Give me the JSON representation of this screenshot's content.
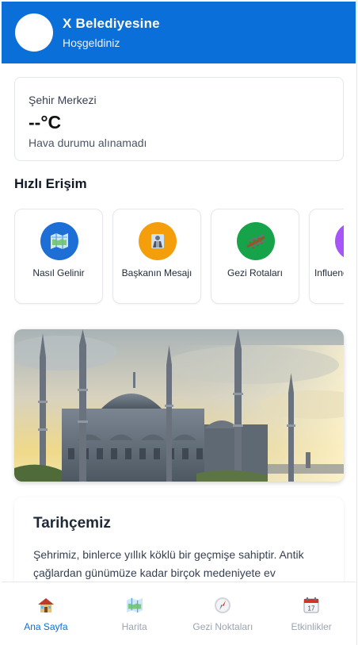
{
  "header": {
    "title": "X Belediyesine",
    "subtitle": "Hoşgeldiniz"
  },
  "weather": {
    "city": "Şehir Merkezi",
    "temperature": "--°C",
    "status": "Hava durumu alınamadı"
  },
  "quick_access": {
    "title": "Hızlı Erişim",
    "items": [
      {
        "label": "Nasıl Gelinir",
        "icon": "map-icon",
        "color": "#1d6fd6"
      },
      {
        "label": "Başkanın Mesajı",
        "icon": "speaker-icon",
        "color": "#f59e0b"
      },
      {
        "label": "Gezi Rotaları",
        "icon": "railway-icon",
        "color": "#16a34a"
      },
      {
        "label": "Influencer Rotaları",
        "icon": "person-icon",
        "color": "#a855f7"
      }
    ]
  },
  "hero": {
    "icon": "mosque-photo"
  },
  "history": {
    "title": "Tarihçemiz",
    "text": "Şehrimiz, binlerce yıllık köklü bir geçmişe sahiptir. Antik çağlardan günümüze kadar birçok medeniyete ev"
  },
  "bottom_nav": {
    "items": [
      {
        "label": "Ana Sayfa",
        "icon": "house-icon",
        "active": true
      },
      {
        "label": "Harita",
        "icon": "map-icon",
        "active": false
      },
      {
        "label": "Gezi Noktaları",
        "icon": "compass-icon",
        "active": false
      },
      {
        "label": "Etkinlikler",
        "icon": "calendar-icon",
        "active": false
      }
    ]
  },
  "colors": {
    "primary": "#0b6fd9",
    "inactive_nav": "#9ca3af"
  }
}
